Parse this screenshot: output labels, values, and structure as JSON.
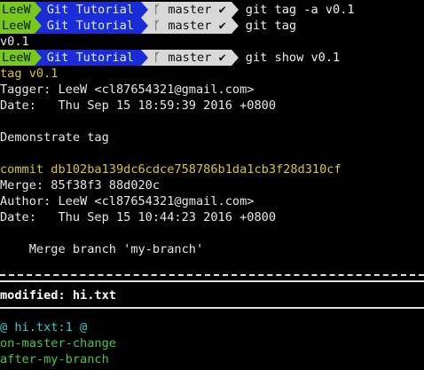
{
  "prompt": {
    "user": "LeeW",
    "dir": "Git Tutorial",
    "branch_icon": "git-branch-glyph",
    "branch_glyph": "ᚴ",
    "branch": "master",
    "status_mark": "✔"
  },
  "lines": {
    "cmd1": "git tag -a v0.1",
    "cmd2": "git tag",
    "out_tag_list": "v0.1",
    "cmd3": "git show v0.1",
    "tag_header": "tag v0.1",
    "tagger": "Tagger: LeeW <cl87654321@gmail.com>",
    "tag_date": "Date:   Thu Sep 15 18:59:39 2016 +0800",
    "tag_message": "Demonstrate tag",
    "commit": "commit db102ba139dc6cdce758786b1da1cb3f28d310cf",
    "merge": "Merge: 85f38f3 88d020c",
    "author": "Author: LeeW <cl87654321@gmail.com>",
    "commit_date": "Date:   Thu Sep 15 10:44:23 2016 +0800",
    "commit_message": "    Merge branch 'my-branch'",
    "modified_label": "modified: hi.txt",
    "hunk_header": "@ hi.txt:1 @",
    "added1": "on-master-change",
    "added2": "after-my-branch"
  },
  "colors": {
    "background": "#000000",
    "user_segment": "#78c81e",
    "dir_segment": "#1a2bd8",
    "branch_segment": "#d8d8d8",
    "yellow": "#d8c43a",
    "cyan": "#3ac8c8",
    "green": "#4cc44c"
  }
}
